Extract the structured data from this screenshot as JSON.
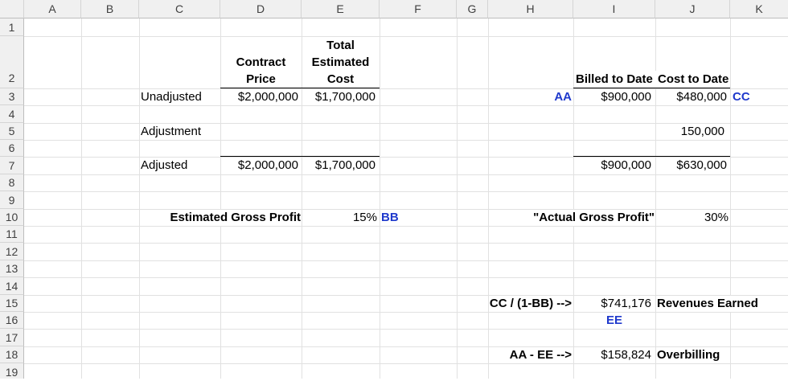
{
  "columns": [
    "A",
    "B",
    "C",
    "D",
    "E",
    "F",
    "G",
    "H",
    "I",
    "J",
    "K"
  ],
  "rows": [
    "1",
    "2",
    "3",
    "4",
    "5",
    "6",
    "7",
    "8",
    "9",
    "10",
    "11",
    "12",
    "13",
    "14",
    "15",
    "16",
    "17",
    "18",
    "19"
  ],
  "header": {
    "contract_price": [
      "Contract",
      "Price"
    ],
    "total_estimated_cost": [
      "Total",
      "Estimated",
      "Cost"
    ],
    "billed_to_date": "Billed to Date",
    "cost_to_date": "Cost to Date"
  },
  "rows_data": {
    "unadjusted": {
      "label": "Unadjusted",
      "contract": "$2,000,000",
      "estimated": "$1,700,000",
      "tag_aa": "AA",
      "billed": "$900,000",
      "cost": "$480,000",
      "tag_cc": "CC"
    },
    "adjustment": {
      "label": "Adjustment",
      "cost": "150,000"
    },
    "adjusted": {
      "label": "Adjusted",
      "contract": "$2,000,000",
      "estimated": "$1,700,000",
      "billed": "$900,000",
      "cost": "$630,000"
    }
  },
  "profit": {
    "estimated_label": "Estimated Gross Profit",
    "estimated_value": "15%",
    "tag_bb": "BB",
    "actual_label": "\"Actual Gross Profit\"",
    "actual_value": "30%"
  },
  "calc": {
    "formula1": "CC / (1-BB) -->",
    "revenue_value": "$741,176",
    "revenue_label": "Revenues Earned",
    "tag_ee": "EE",
    "formula2": "AA - EE -->",
    "overbilling_value": "$158,824",
    "overbilling_label": "Overbilling"
  }
}
